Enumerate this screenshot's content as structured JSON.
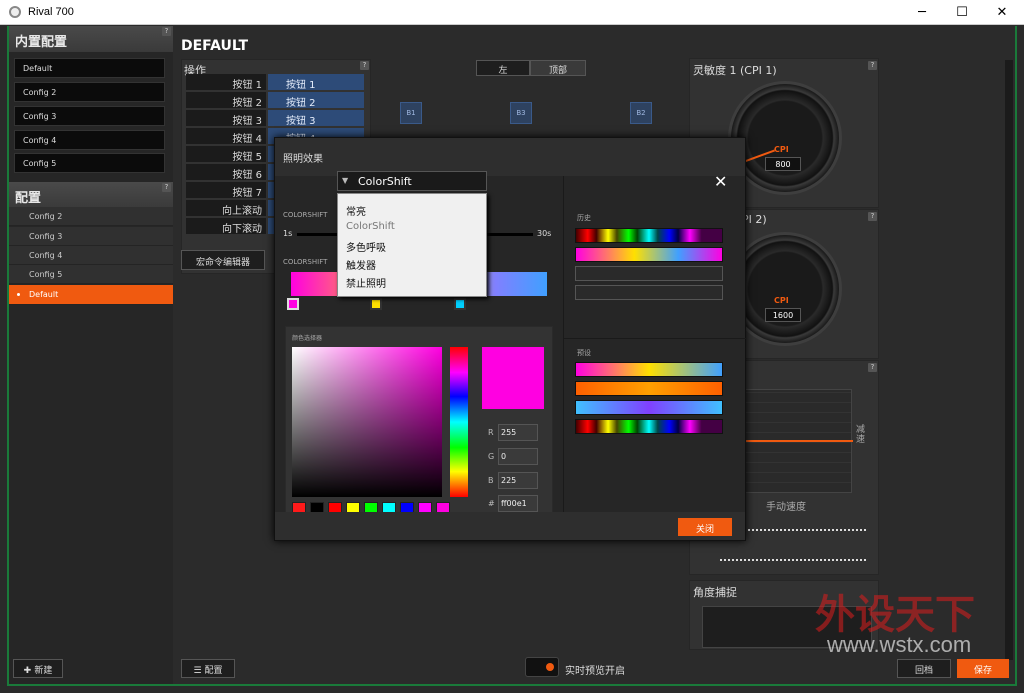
{
  "window": {
    "title": "Rival 700",
    "controls": {
      "minimize": "─",
      "maximize": "☐",
      "close": "✕"
    }
  },
  "left": {
    "builtin_header": "内置配置",
    "builtin_configs": [
      "Default",
      "Config 2",
      "Config 3",
      "Config 4",
      "Config 5"
    ],
    "profiles_header": "配置",
    "profiles": [
      "Config 2",
      "Config 3",
      "Config 4",
      "Config 5",
      "Default"
    ],
    "active_profile": "Default",
    "new_button": "新建",
    "help": "?"
  },
  "main": {
    "title": "DEFAULT",
    "actions_header": "操作",
    "view_tabs": [
      "左",
      "顶部"
    ],
    "buttons": [
      {
        "name": "按钮 1",
        "action": "按钮 1"
      },
      {
        "name": "按钮 2",
        "action": "按钮 2"
      },
      {
        "name": "按钮 3",
        "action": "按钮 3"
      },
      {
        "name": "按钮 4",
        "action": "按钮 4"
      },
      {
        "name": "按钮 5",
        "action": "按钮 5"
      },
      {
        "name": "按钮 6",
        "action": ""
      },
      {
        "name": "按钮 7",
        "action": ""
      },
      {
        "name": "向上滚动",
        "action": ""
      },
      {
        "name": "向下滚动",
        "action": ""
      }
    ],
    "macro_editor": "宏命令编辑器",
    "diagram_labels": {
      "b1": "B1",
      "b2": "B2",
      "b3": "B3"
    },
    "sensitivity1": "灵敏度 1 (CPI 1)",
    "sensitivity2": "PI 2)",
    "cpi_label": "CPI",
    "cpi1_value": "800",
    "cpi2_value": "1600",
    "accel_x_label": "手动速度",
    "accel_y_label": "减速",
    "angle_snap": "角度捕捉",
    "config_button": "配置",
    "live_preview": "实时预览开启",
    "revert_button": "回档",
    "save_button": "保存",
    "watermark_text": "外设天下",
    "watermark_url": "www.wstx.com"
  },
  "dialog": {
    "effect_label": "照明效果",
    "effect_value": "ColorShift",
    "menu_options": [
      "常亮",
      "ColorShift",
      "多色呼吸",
      "触发器",
      "禁止照明"
    ],
    "speed_section": "COLORSHIFT",
    "speed_min": "1s",
    "speed_max": "30s",
    "color_section": "COLORSHIFT",
    "picker_title": "颜色选择器",
    "r_label": "R",
    "r_value": "255",
    "g_label": "G",
    "g_value": "0",
    "b_label": "B",
    "b_value": "225",
    "hex_label": "#",
    "hex_value": "ff00e1",
    "history_label": "历史",
    "presets_label": "预设",
    "close_button": "关闭",
    "close_x": "✕",
    "selected_color": "#ff00e1",
    "quick_swatches": [
      "#ff1a1a",
      "#000000",
      "#ff0000",
      "#ffff00",
      "#00ff00",
      "#00ffff",
      "#0000ff",
      "#ff00ff",
      "#ff00e1"
    ]
  },
  "colors": {
    "accent": "#f05a10",
    "blue": "#2d4b78",
    "frame": "#1a7a3a"
  }
}
